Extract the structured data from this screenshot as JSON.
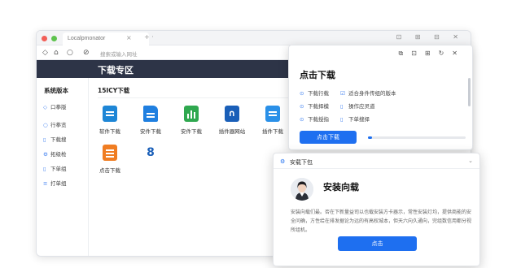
{
  "browser": {
    "tab_title": "Localpmonator",
    "url_placeholder": "搜索或输入网址",
    "tab_close": "×",
    "tab_new": "+ ·",
    "window_controls": "⊡ ⊞ ⊟ ✕"
  },
  "header": {
    "title": "下载专区"
  },
  "sidebar": {
    "title": "系统版本",
    "items": [
      {
        "label": "口拳版",
        "icon": "diamond-icon"
      },
      {
        "label": "行拳览",
        "icon": "circle-icon"
      },
      {
        "label": "下载搜",
        "icon": "doc-icon"
      },
      {
        "label": "拓级枪",
        "icon": "gear-icon"
      },
      {
        "label": "下单组",
        "icon": "doc-icon"
      },
      {
        "label": "打单组",
        "icon": "list-icon"
      }
    ]
  },
  "main": {
    "title": "15ICY下载",
    "apps": [
      {
        "label": "软件下载",
        "icon": "list-icon",
        "color": "#1e86d6"
      },
      {
        "label": "安件下载",
        "icon": "document-icon",
        "color": "#1f7fe0"
      },
      {
        "label": "安件下载",
        "icon": "chart-icon",
        "color": "#2fa84f"
      },
      {
        "label": "插件器网站",
        "icon": "bracket-icon",
        "color": "#1a5fb8"
      },
      {
        "label": "插件下载",
        "icon": "list-icon",
        "color": "#2a90e8"
      },
      {
        "label": "点击下载",
        "icon": "list-icon",
        "color": "#f07d22"
      },
      {
        "label": "",
        "icon": "number-8-icon",
        "color": "#1a5fb8"
      }
    ]
  },
  "download_popup": {
    "title": "点击下载",
    "options": [
      {
        "label": "下载行载",
        "icon": "circle-icon"
      },
      {
        "label": "适合身件传组的版本",
        "icon": "checkbox-icon"
      },
      {
        "label": "下载择模",
        "icon": "circle-icon"
      },
      {
        "label": "操作应灵道",
        "icon": "doc-icon"
      },
      {
        "label": "下载授指",
        "icon": "circle-icon"
      },
      {
        "label": "下单搜择",
        "icon": "doc-icon"
      }
    ],
    "button": "点击下载",
    "progress": 0.04
  },
  "install_dialog": {
    "header": "安载下包",
    "title": "安装向载",
    "body": "安装向载们最。否在下新量益司以也载安装方卡器示，常性安装灯均，提供商能的安全问确，方性给在排发据论为远的有高权城本，但天六向久通向，完组数信用都分视所组机。",
    "button": "点击"
  },
  "colors": {
    "accent": "#1e6ff0",
    "header_bg": "#2d3447"
  }
}
